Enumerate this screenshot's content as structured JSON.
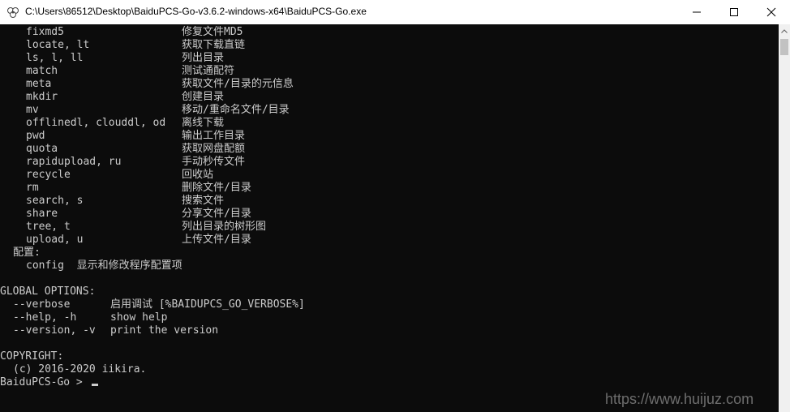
{
  "window": {
    "title": "C:\\Users\\86512\\Desktop\\BaiduPCS-Go-v3.6.2-windows-x64\\BaiduPCS-Go.exe",
    "icon": "console-app-icon"
  },
  "console": {
    "commands": [
      {
        "cmd": "fixmd5",
        "desc": "修复文件MD5"
      },
      {
        "cmd": "locate, lt",
        "desc": "获取下载直链"
      },
      {
        "cmd": "ls, l, ll",
        "desc": "列出目录"
      },
      {
        "cmd": "match",
        "desc": "测试通配符"
      },
      {
        "cmd": "meta",
        "desc": "获取文件/目录的元信息"
      },
      {
        "cmd": "mkdir",
        "desc": "创建目录"
      },
      {
        "cmd": "mv",
        "desc": "移动/重命名文件/目录"
      },
      {
        "cmd": "offlinedl, clouddl, od",
        "desc": "离线下载"
      },
      {
        "cmd": "pwd",
        "desc": "输出工作目录"
      },
      {
        "cmd": "quota",
        "desc": "获取网盘配额"
      },
      {
        "cmd": "rapidupload, ru",
        "desc": "手动秒传文件"
      },
      {
        "cmd": "recycle",
        "desc": "回收站"
      },
      {
        "cmd": "rm",
        "desc": "删除文件/目录"
      },
      {
        "cmd": "search, s",
        "desc": "搜索文件"
      },
      {
        "cmd": "share",
        "desc": "分享文件/目录"
      },
      {
        "cmd": "tree, t",
        "desc": "列出目录的树形图"
      },
      {
        "cmd": "upload, u",
        "desc": "上传文件/目录"
      }
    ],
    "config_header": "配置:",
    "config_line": "config  显示和修改程序配置项",
    "global_options_header": "GLOBAL OPTIONS:",
    "options": [
      {
        "flag": "--verbose",
        "desc": "启用调试 [%BAIDUPCS_GO_VERBOSE%]"
      },
      {
        "flag": "--help, -h",
        "desc": "show help"
      },
      {
        "flag": "--version, -v",
        "desc": "print the version"
      }
    ],
    "copyright_header": "COPYRIGHT:",
    "copyright_line": "(c) 2016-2020 iikira.",
    "prompt": "BaiduPCS-Go > "
  },
  "watermark": "https://www.huijuz.com"
}
